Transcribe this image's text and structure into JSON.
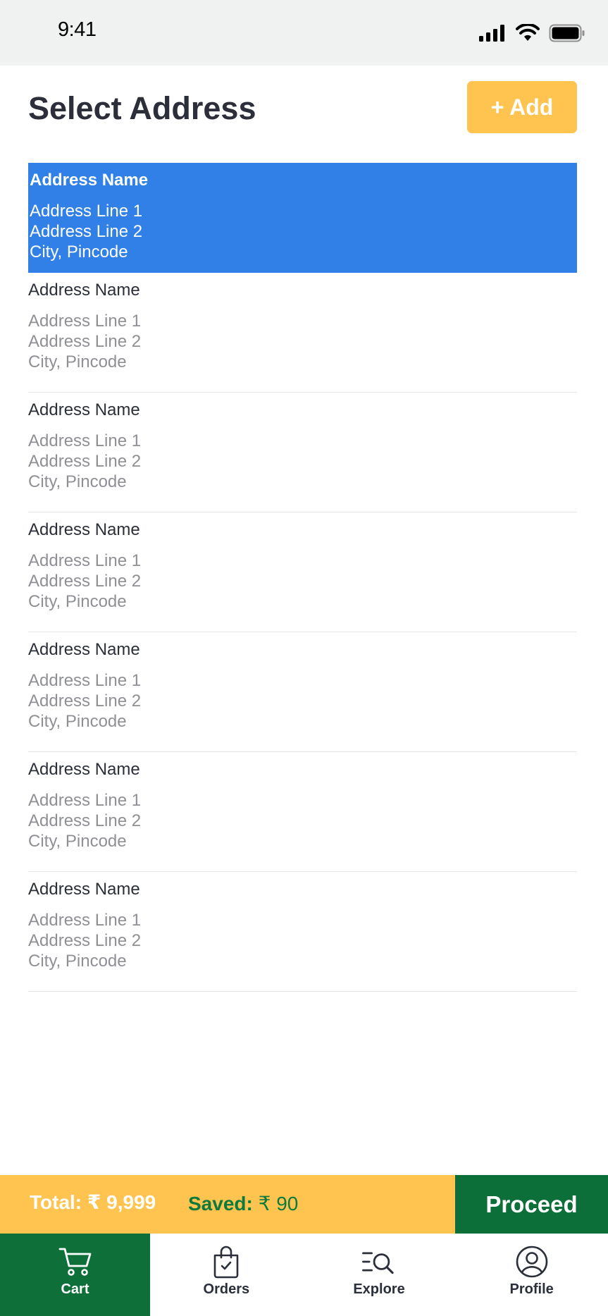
{
  "status_bar": {
    "time": "9:41"
  },
  "header": {
    "title": "Select Address",
    "add_label": "+ Add"
  },
  "addresses": [
    {
      "name": "Address Name",
      "line1": "Address Line 1",
      "line2": "Address Line 2",
      "city": "City, Pincode",
      "selected": true
    },
    {
      "name": "Address Name",
      "line1": "Address Line 1",
      "line2": "Address Line 2",
      "city": "City, Pincode",
      "selected": false
    },
    {
      "name": "Address Name",
      "line1": "Address Line 1",
      "line2": "Address Line 2",
      "city": "City, Pincode",
      "selected": false
    },
    {
      "name": "Address Name",
      "line1": "Address Line 1",
      "line2": "Address Line 2",
      "city": "City, Pincode",
      "selected": false
    },
    {
      "name": "Address Name",
      "line1": "Address Line 1",
      "line2": "Address Line 2",
      "city": "City, Pincode",
      "selected": false
    },
    {
      "name": "Address Name",
      "line1": "Address Line 1",
      "line2": "Address Line 2",
      "city": "City, Pincode",
      "selected": false
    },
    {
      "name": "Address Name",
      "line1": "Address Line 1",
      "line2": "Address Line 2",
      "city": "City, Pincode",
      "selected": false
    }
  ],
  "summary": {
    "total_label": "Total:",
    "total_value": "₹ 9,999",
    "saved_label": "Saved:",
    "saved_value": "₹ 90",
    "proceed_label": "Proceed"
  },
  "bottom_nav": {
    "items": [
      {
        "label": "Cart",
        "icon": "cart-icon",
        "active": true
      },
      {
        "label": "Orders",
        "icon": "shopping-bag-icon",
        "active": false
      },
      {
        "label": "Explore",
        "icon": "explore-search-icon",
        "active": false
      },
      {
        "label": "Profile",
        "icon": "user-circle-icon",
        "active": false
      }
    ]
  },
  "colors": {
    "accent_yellow": "#fec44f",
    "selected_blue": "#3080e8",
    "brand_green": "#0c6e38",
    "saved_green": "#0e7a3c"
  }
}
